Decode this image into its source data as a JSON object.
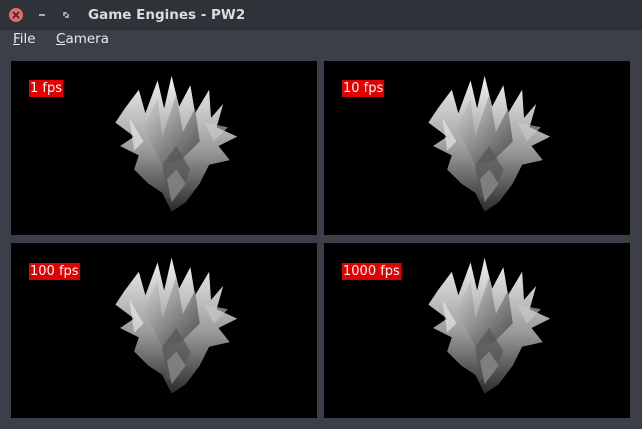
{
  "window": {
    "title": "Game Engines - PW2"
  },
  "menu": {
    "file": "File",
    "camera": "Camera"
  },
  "viewports": [
    {
      "fps_label": "1 fps"
    },
    {
      "fps_label": "10 fps"
    },
    {
      "fps_label": "100 fps"
    },
    {
      "fps_label": "1000 fps"
    }
  ],
  "colors": {
    "fps_badge": "#e00000",
    "close_button": "#e46b63",
    "viewport_bg": "#000000"
  }
}
